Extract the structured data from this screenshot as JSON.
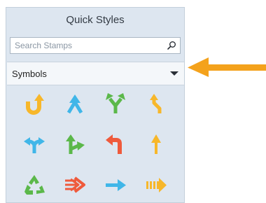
{
  "panel": {
    "title": "Quick Styles"
  },
  "search": {
    "placeholder": "Search Stamps",
    "value": "",
    "icon": "search-icon"
  },
  "dropdown": {
    "selected": "Symbols",
    "icon": "chevron-down-icon"
  },
  "stamps": [
    {
      "name": "u-turn-arrow-icon",
      "color": "#f7b72a"
    },
    {
      "name": "merge-arrow-icon",
      "color": "#40b6e8"
    },
    {
      "name": "split-arrow-icon",
      "color": "#5bb84a"
    },
    {
      "name": "zigzag-arrow-icon",
      "color": "#f7b72a"
    },
    {
      "name": "fork-arrow-icon",
      "color": "#40b6e8"
    },
    {
      "name": "branch-right-arrow-icon",
      "color": "#5bb84a"
    },
    {
      "name": "turn-left-arrow-icon",
      "color": "#ef5a3c"
    },
    {
      "name": "up-arrow-icon",
      "color": "#f7b72a"
    },
    {
      "name": "recycle-icon",
      "color": "#5bb84a"
    },
    {
      "name": "triple-chevron-arrow-icon",
      "color": "#ef5a3c"
    },
    {
      "name": "right-arrow-icon",
      "color": "#40b6e8"
    },
    {
      "name": "striped-arrow-icon",
      "color": "#f7b72a"
    }
  ],
  "callout": {
    "color": "#f4a21c"
  }
}
